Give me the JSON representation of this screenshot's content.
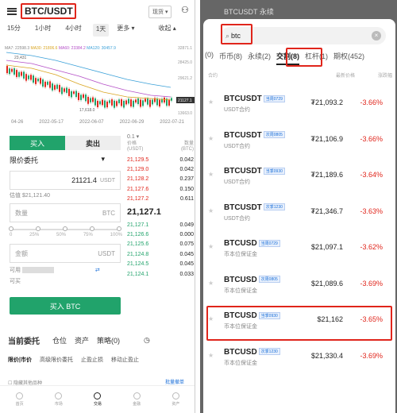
{
  "left": {
    "pair": "BTC/USDT",
    "spot_label": "现货 ▾",
    "top_icon": "⚇",
    "timeframes": [
      "15分",
      "1小时",
      "4小时",
      "1天",
      "更多 ▾",
      "收起 ▴"
    ],
    "ma_line": {
      "ma7": "MA7: 22598.3",
      "ma30": "MA30: 21806.6",
      "ma60": "MA60: 23384.2",
      "ma120": "MA120: 30457.9"
    },
    "chart_labels": {
      "high": "23,431",
      "low": "17,618.0",
      "last": "21127.1"
    },
    "y_ticks": [
      "32871.1",
      "28425.0",
      "29621.2",
      "21127.1",
      "13663.0"
    ],
    "dates": [
      "04-26",
      "2022-05-17",
      "2022-06-07",
      "2022-06-29",
      "2022-07-21"
    ],
    "buy_tab": "买入",
    "sell_tab": "卖出",
    "order_type": "限价委托",
    "price_value": "21121.4",
    "price_unit": "USDT",
    "estimate": "估值 $21,121.40",
    "qty_placeholder": "数量",
    "qty_unit": "BTC",
    "pct": [
      "0",
      "25%",
      "50%",
      "75%",
      "100%"
    ],
    "amount_placeholder": "金额",
    "amount_unit": "USDT",
    "avail_label": "可用",
    "buyable_label": "可买",
    "buy_button": "买入 BTC",
    "orderbook": {
      "head_left": "0.1 ▾",
      "col_price": "价格",
      "col_price_unit": "(USDT)",
      "col_qty": "数量",
      "col_qty_unit": "(BTC)",
      "asks": [
        {
          "p": "21,129.5",
          "q": "0.042"
        },
        {
          "p": "21,129.0",
          "q": "0.042"
        },
        {
          "p": "21,128.2",
          "q": "0.237"
        },
        {
          "p": "21,127.6",
          "q": "0.150"
        },
        {
          "p": "21,127.2",
          "q": "0.611"
        }
      ],
      "mid": "21,127.1",
      "bids": [
        {
          "p": "21,127.1",
          "q": "0.049"
        },
        {
          "p": "21,126.6",
          "q": "0.000"
        },
        {
          "p": "21,125.6",
          "q": "0.075"
        },
        {
          "p": "21,124.8",
          "q": "0.045"
        },
        {
          "p": "21,124.5",
          "q": "0.045"
        },
        {
          "p": "21,124.1",
          "q": "0.033"
        }
      ]
    },
    "bottom_tabs": [
      "当前委托",
      "仓位",
      "资产",
      "策略(0)"
    ],
    "filters": [
      "限价|市价",
      "高级限价委托",
      "止盈止损",
      "移动止盈止"
    ],
    "hide_other": "隐藏其他品种",
    "batch_cancel": "批量撤单",
    "nav": [
      "首页",
      "市场",
      "交易",
      "金融",
      "资产"
    ]
  },
  "right": {
    "header_text": "BTCUSDT 永续",
    "search_icon": "⌕",
    "search_query": "btc",
    "clear_icon": "×",
    "categories": [
      "(0)",
      "币币(8)",
      "永续(2)",
      "交割(8)",
      "杠杆(1)",
      "期权(452)"
    ],
    "active_category": "交割(8)",
    "col_name": "合约",
    "col_price": "最新价格",
    "col_change": "涨跌幅",
    "items": [
      {
        "sym": "BTCUSDT",
        "tag": "当周0729",
        "sub": "USDT合约",
        "price": "₮21,093.2",
        "chg": "-3.66%"
      },
      {
        "sym": "BTCUSDT",
        "tag": "次周0805",
        "sub": "USDT合约",
        "price": "₮21,106.9",
        "chg": "-3.66%"
      },
      {
        "sym": "BTCUSDT",
        "tag": "当季0930",
        "sub": "USDT合约",
        "price": "₮21,189.6",
        "chg": "-3.64%"
      },
      {
        "sym": "BTCUSDT",
        "tag": "次季1230",
        "sub": "USDT合约",
        "price": "₮21,346.7",
        "chg": "-3.63%"
      },
      {
        "sym": "BTCUSD",
        "tag": "当周0729",
        "sub": "币本位保证金",
        "price": "$21,097.1",
        "chg": "-3.62%"
      },
      {
        "sym": "BTCUSD",
        "tag": "次周0805",
        "sub": "币本位保证金",
        "price": "$21,089.6",
        "chg": "-3.69%"
      },
      {
        "sym": "BTCUSD",
        "tag": "当季0930",
        "sub": "币本位保证金",
        "price": "$21,162",
        "chg": "-3.65%"
      },
      {
        "sym": "BTCUSD",
        "tag": "次季1230",
        "sub": "币本位保证金",
        "price": "$21,330.4",
        "chg": "-3.69%"
      }
    ]
  },
  "colors": {
    "green": "#21a36b",
    "red": "#e0251b",
    "highlight": "#e0251b"
  }
}
